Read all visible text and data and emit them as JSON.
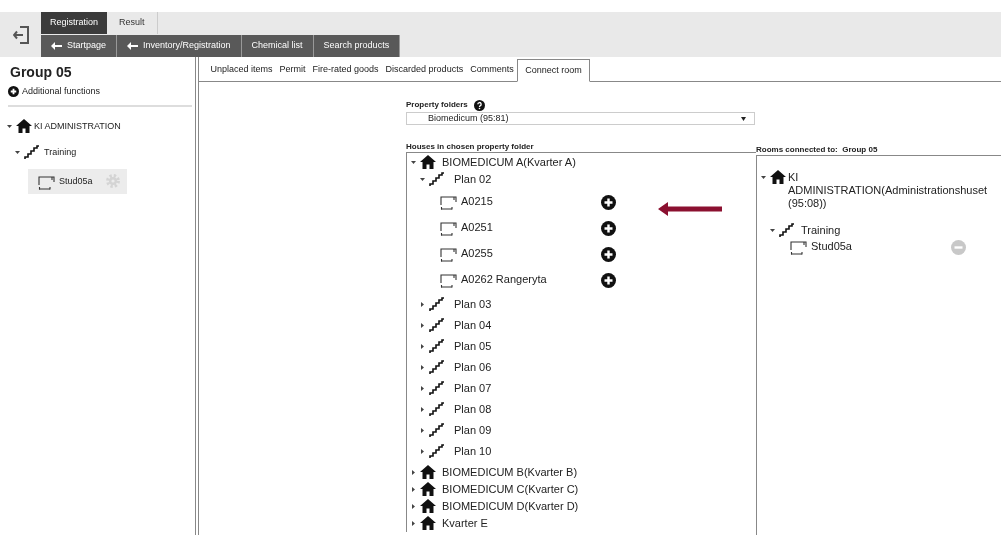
{
  "top_tabs": [
    {
      "label": "Registration",
      "selected": true
    },
    {
      "label": "Result",
      "selected": false
    }
  ],
  "nav_buttons": [
    {
      "label": "Startpage",
      "kind": "back"
    },
    {
      "label": "Inventory/Registration",
      "kind": "back"
    },
    {
      "label": "Chemical list",
      "kind": "plain"
    },
    {
      "label": "Search products",
      "kind": "plain"
    }
  ],
  "sidebar": {
    "title": "Group 05",
    "additional_functions": "Additional functions",
    "tree": [
      {
        "kind": "house",
        "label": "KI ADMINISTRATION",
        "expanded": true,
        "children": [
          {
            "kind": "floor",
            "label": "Training",
            "expanded": true,
            "children": [
              {
                "kind": "room",
                "label": "Stud05a",
                "selected": true
              }
            ]
          }
        ]
      }
    ]
  },
  "content_tabs": [
    {
      "label": "Unplaced items",
      "selected": false
    },
    {
      "label": "Permit",
      "selected": false
    },
    {
      "label": "Fire-rated goods",
      "selected": false
    },
    {
      "label": "Discarded products",
      "selected": false
    },
    {
      "label": "Comments",
      "selected": false
    },
    {
      "label": "Connect room",
      "selected": true
    }
  ],
  "property_folders": {
    "label": "Property folders",
    "value": "Biomedicum (95:81)"
  },
  "houses": {
    "label": "Houses in chosen property folder",
    "tree": [
      {
        "kind": "house",
        "label": "BIOMEDICUM A(Kvarter A)",
        "expanded": true,
        "children": [
          {
            "kind": "floor",
            "label": "Plan 02",
            "expanded": true,
            "children": [
              {
                "kind": "room",
                "label": "A0215",
                "connected": false
              },
              {
                "kind": "room",
                "label": "A0251",
                "connected": false
              },
              {
                "kind": "room",
                "label": "A0255",
                "connected": false
              },
              {
                "kind": "room",
                "label": "A0262 Rangeryta",
                "connected": false
              }
            ]
          },
          {
            "kind": "floor",
            "label": "Plan 03",
            "expanded": false
          },
          {
            "kind": "floor",
            "label": "Plan 04",
            "expanded": false
          },
          {
            "kind": "floor",
            "label": "Plan 05",
            "expanded": false
          },
          {
            "kind": "floor",
            "label": "Plan 06",
            "expanded": false
          },
          {
            "kind": "floor",
            "label": "Plan 07",
            "expanded": false
          },
          {
            "kind": "floor",
            "label": "Plan 08",
            "expanded": false
          },
          {
            "kind": "floor",
            "label": "Plan 09",
            "expanded": false
          },
          {
            "kind": "floor",
            "label": "Plan 10",
            "expanded": false
          }
        ]
      },
      {
        "kind": "house",
        "label": "BIOMEDICUM B(Kvarter B)",
        "expanded": false
      },
      {
        "kind": "house",
        "label": "BIOMEDICUM C(Kvarter C)",
        "expanded": false
      },
      {
        "kind": "house",
        "label": "BIOMEDICUM D(Kvarter D)",
        "expanded": false
      },
      {
        "kind": "house",
        "label": "Kvarter E",
        "expanded": false
      }
    ]
  },
  "rooms_connected": {
    "label": "Rooms connected to:  Group 05",
    "tree": [
      {
        "kind": "house",
        "label": "KI ADMINISTRATION(Administrationshuset (95:08))",
        "expanded": true,
        "children": [
          {
            "kind": "floor",
            "label": "Training",
            "expanded": true,
            "children": [
              {
                "kind": "room",
                "label": "Stud05a",
                "connected": true
              }
            ]
          }
        ]
      }
    ]
  }
}
